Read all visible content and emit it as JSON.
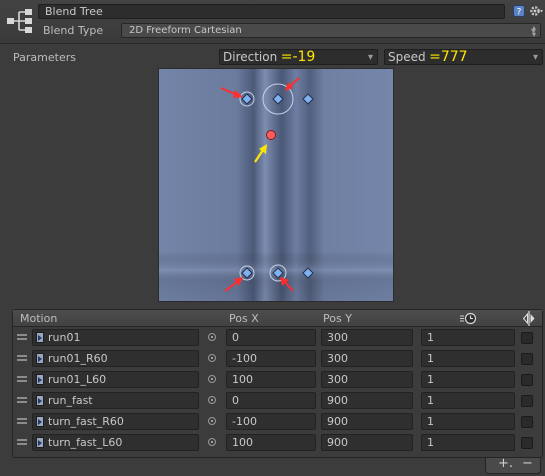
{
  "header": {
    "name_value": "Blend Tree",
    "blend_type_label": "Blend Type",
    "blend_type_value": "2D Freeform Cartesian"
  },
  "parameters": {
    "label": "Parameters",
    "x_param": "Direction",
    "x_value": "=-19",
    "y_param": "Speed",
    "y_value": "=777"
  },
  "table": {
    "headers": {
      "motion": "Motion",
      "pos_x": "Pos X",
      "pos_y": "Pos Y"
    },
    "rows": [
      {
        "motion": "run01",
        "pos_x": "0",
        "pos_y": "300",
        "speed": "1"
      },
      {
        "motion": "run01_R60",
        "pos_x": "-100",
        "pos_y": "300",
        "speed": "1"
      },
      {
        "motion": "run01_L60",
        "pos_x": "100",
        "pos_y": "300",
        "speed": "1"
      },
      {
        "motion": "run_fast",
        "pos_x": "0",
        "pos_y": "900",
        "speed": "1"
      },
      {
        "motion": "turn_fast_R60",
        "pos_x": "-100",
        "pos_y": "900",
        "speed": "1"
      },
      {
        "motion": "turn_fast_L60",
        "pos_x": "100",
        "pos_y": "900",
        "speed": "1"
      }
    ],
    "footer": {
      "add_label": "+.",
      "remove_label": "−"
    }
  },
  "colors": {
    "background": "#3c3c3c",
    "blend_area": "#6d7da0",
    "motion_point": "#7fb2f0",
    "current_point": "#ff5b5b",
    "annotation_red": "#ff2d2d",
    "annotation_yellow": "#ffe600"
  },
  "icons": {
    "blend_tree": "blend-tree-icon",
    "help": "help-icon",
    "settings": "gear-icon",
    "speed_column": "clock-icon",
    "mirror_column": "mirror-icon"
  }
}
